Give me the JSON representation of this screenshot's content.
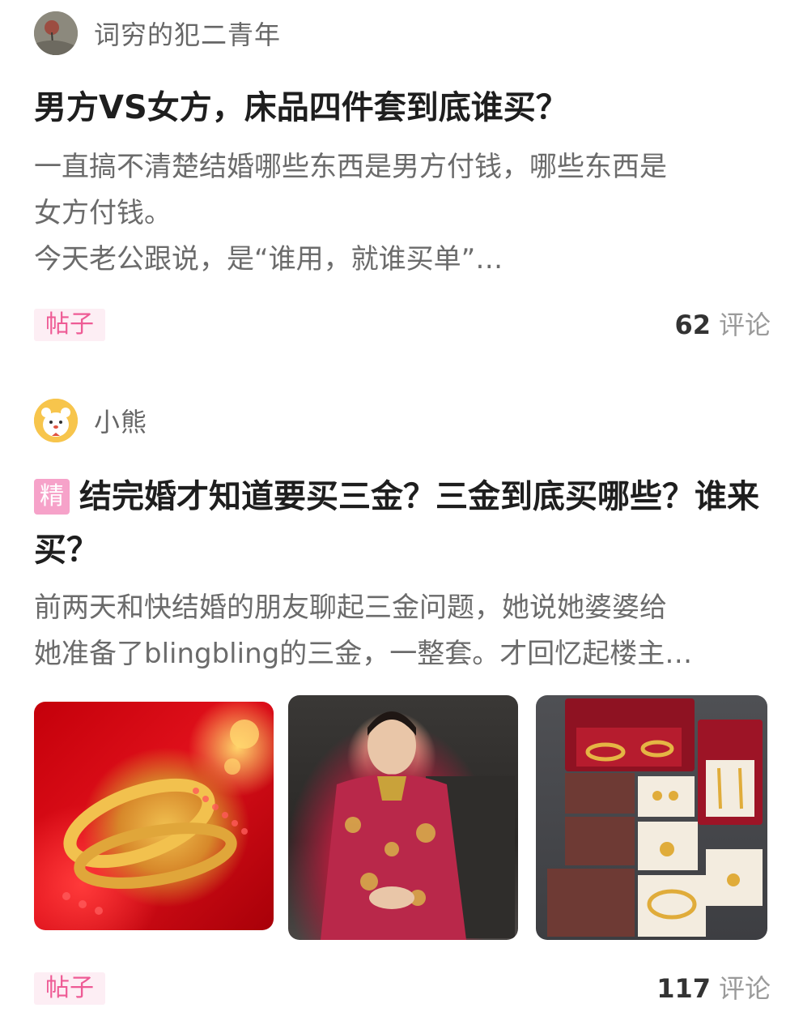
{
  "posts": [
    {
      "author": "词穷的犯二青年",
      "title": "男方VS女方，床品四件套到底谁买？",
      "summary": [
        "一直搞不清楚结婚哪些东西是男方付钱，哪些东西是",
        "女方付钱。",
        "今天老公跟说，是“谁用，就谁买单”…"
      ],
      "type_tag": "帖子",
      "comment_count": "62",
      "comment_label": "评论"
    },
    {
      "author": "小熊",
      "essence_tag": "精",
      "title": "结完婚才知道要买三金？三金到底买哪些？谁来买？",
      "summary": [
        "前两天和快结婚的朋友聊起三金问题，她说她婆婆给",
        "她准备了blingbling的三金，一整套。才回忆起楼主…"
      ],
      "type_tag": "帖子",
      "comment_count": "117",
      "comment_label": "评论"
    }
  ]
}
